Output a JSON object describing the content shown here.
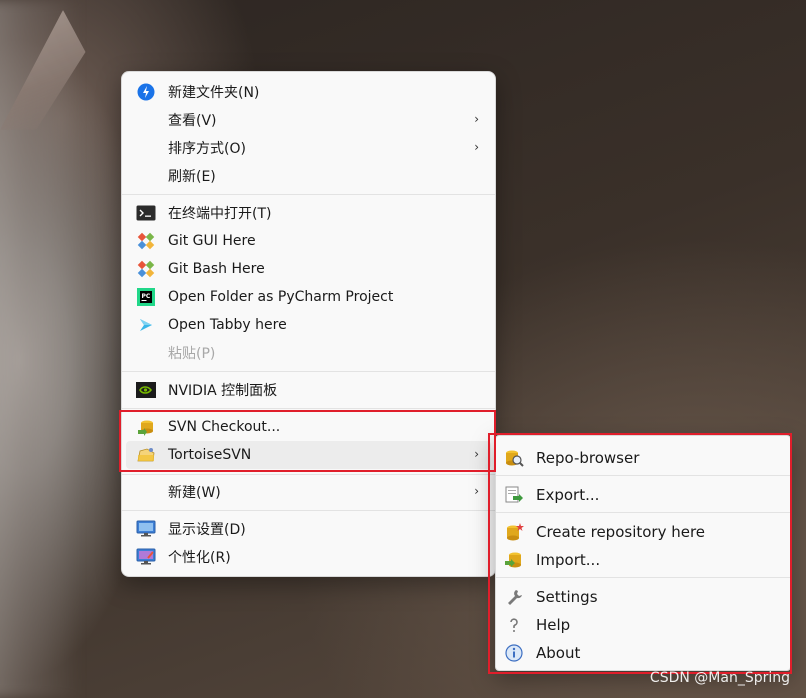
{
  "context_menu": {
    "items": [
      {
        "label": "新建文件夹(N)",
        "icon": "new-folder-icon"
      },
      {
        "label": "查看(V)",
        "has_submenu": true
      },
      {
        "label": "排序方式(O)",
        "has_submenu": true
      },
      {
        "label": "刷新(E)"
      },
      {
        "label": "在终端中打开(T)",
        "icon": "terminal-icon"
      },
      {
        "label": "Git GUI Here",
        "icon": "git-icon"
      },
      {
        "label": "Git Bash Here",
        "icon": "git-icon"
      },
      {
        "label": "Open Folder as PyCharm Project",
        "icon": "pycharm-icon"
      },
      {
        "label": "Open Tabby here",
        "icon": "tabby-icon"
      },
      {
        "label": "粘贴(P)",
        "disabled": true
      },
      {
        "label": "NVIDIA 控制面板",
        "icon": "nvidia-icon"
      },
      {
        "label": "SVN Checkout...",
        "icon": "svn-checkout-icon"
      },
      {
        "label": "TortoiseSVN",
        "icon": "tortoisesvn-icon",
        "has_submenu": true,
        "highlighted": true
      },
      {
        "label": "新建(W)",
        "has_submenu": true
      },
      {
        "label": "显示设置(D)",
        "icon": "display-settings-icon"
      },
      {
        "label": "个性化(R)",
        "icon": "personalize-icon"
      }
    ],
    "submenu_arrow": "›"
  },
  "svn_submenu": {
    "items": [
      {
        "label": "Repo-browser",
        "icon": "repo-browser-icon"
      },
      {
        "label": "Export...",
        "icon": "export-icon"
      },
      {
        "label": "Create repository here",
        "icon": "create-repository-icon"
      },
      {
        "label": "Import...",
        "icon": "import-icon"
      },
      {
        "label": "Settings",
        "icon": "wrench-icon"
      },
      {
        "label": "Help",
        "icon": "help-icon"
      },
      {
        "label": "About",
        "icon": "info-icon"
      }
    ]
  },
  "annotation_color": "#e01e2b",
  "watermark": "CSDN @Man_Spring"
}
